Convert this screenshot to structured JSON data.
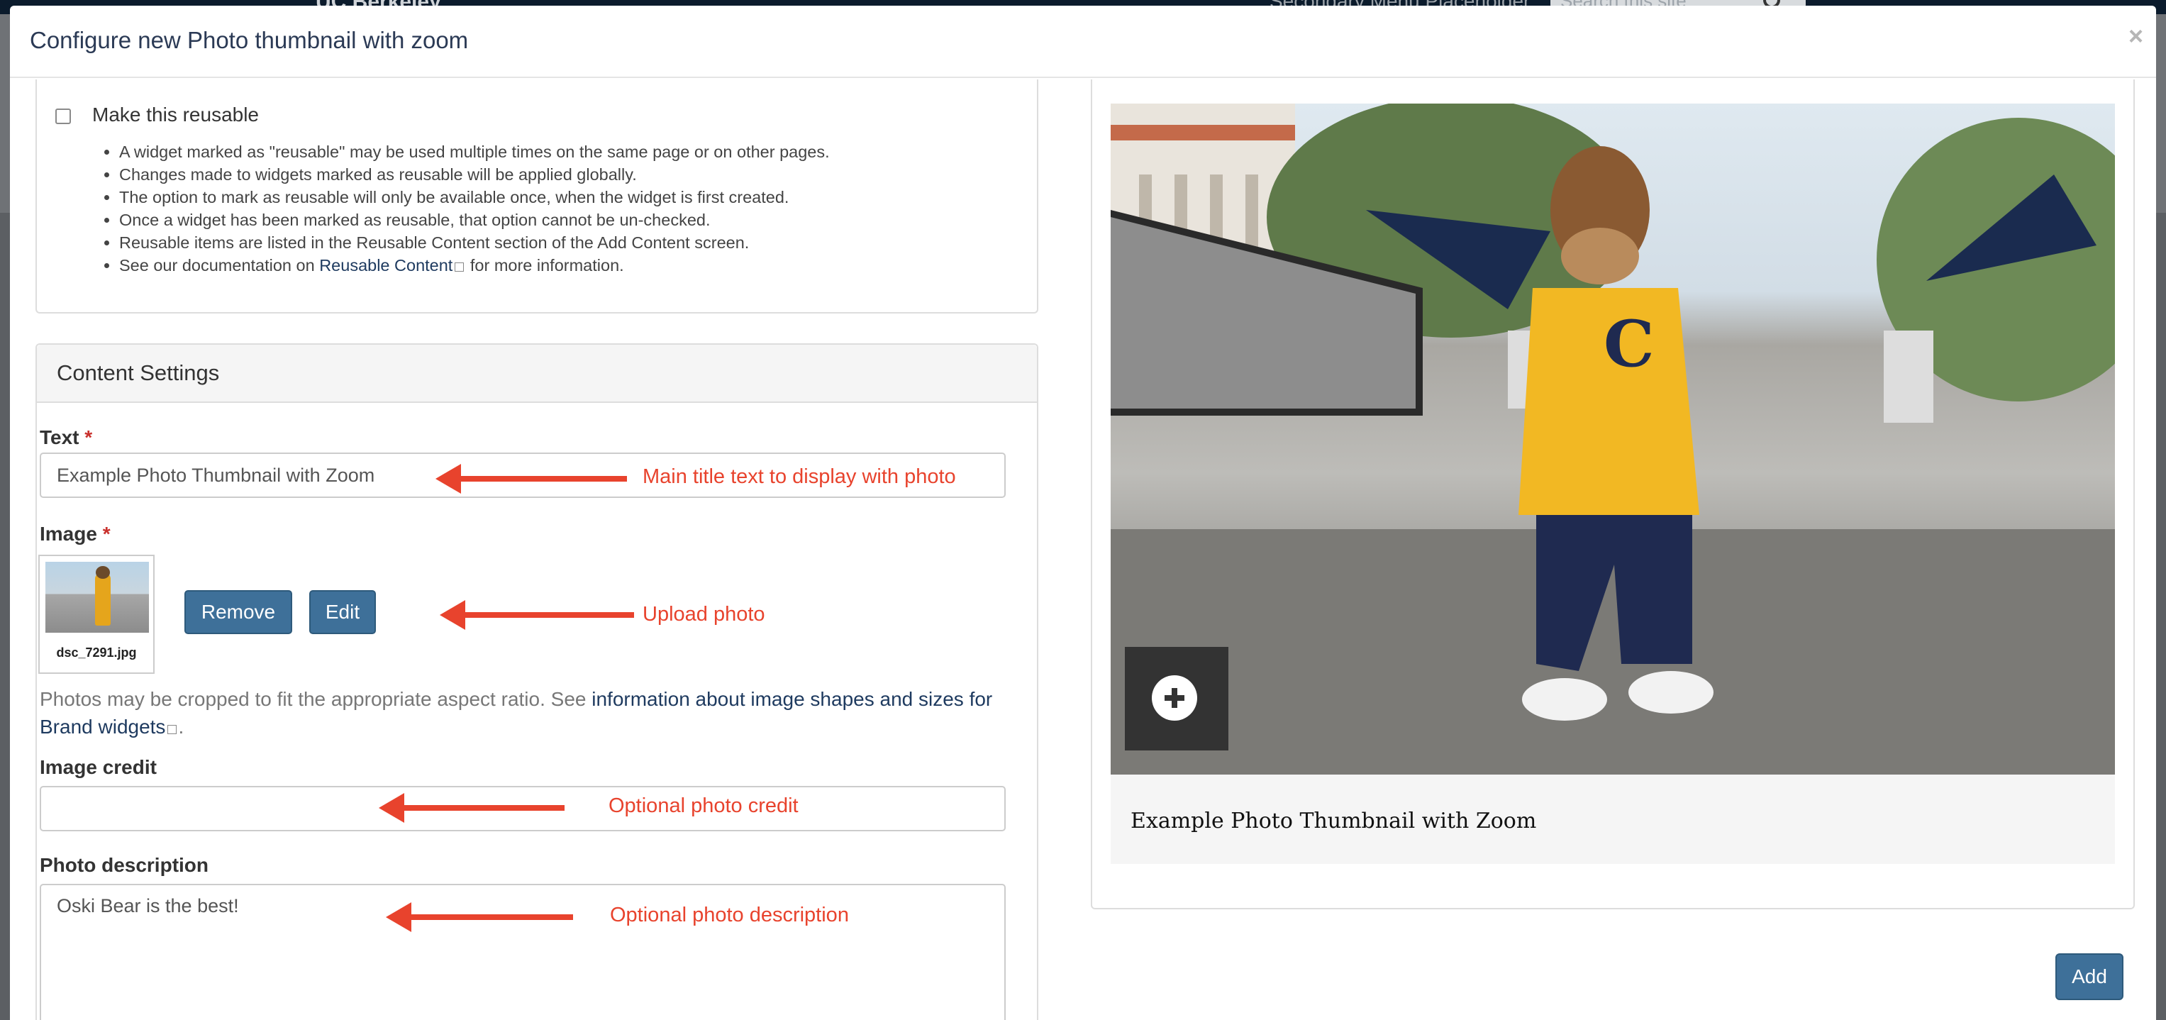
{
  "background_page": {
    "brand": "UC Berkeley",
    "menu": "Secondary Menu Placeholder",
    "search_placeholder": "Search this site"
  },
  "modal": {
    "title": "Configure new Photo thumbnail with zoom",
    "close_label": "×"
  },
  "reusable": {
    "label": "Make this reusable",
    "checked": false,
    "bullets": [
      "A widget marked as \"reusable\" may be used multiple times on the same page or on other pages.",
      "Changes made to widgets marked as reusable will be applied globally.",
      "The option to mark as reusable will only be available once, when the widget is first created.",
      "Once a widget has been marked as reusable, that option cannot be un-checked.",
      "Reusable items are listed in the Reusable Content section of the Add Content screen."
    ],
    "doc_prefix": "See our documentation on ",
    "doc_link": "Reusable Content",
    "doc_suffix": " for more information."
  },
  "content_settings": {
    "heading": "Content Settings",
    "text_field": {
      "label": "Text",
      "required_marker": "*",
      "value": "Example Photo Thumbnail with Zoom"
    },
    "image_field": {
      "label": "Image",
      "required_marker": "*",
      "filename": "dsc_7291.jpg",
      "remove_label": "Remove",
      "edit_label": "Edit"
    },
    "help": {
      "prefix": "Photos may be cropped to fit the appropriate aspect ratio. See ",
      "link": "information about image shapes and sizes for Brand widgets",
      "suffix": "."
    },
    "credit_field": {
      "label": "Image credit",
      "value": ""
    },
    "description_field": {
      "label": "Photo description",
      "value": "Oski Bear is the best!"
    }
  },
  "annotations": {
    "text": "Main title text to display with photo",
    "upload": "Upload photo",
    "credit": "Optional photo credit",
    "description": "Optional photo description",
    "color": "#e8432d"
  },
  "preview": {
    "caption": "Example Photo Thumbnail with Zoom",
    "zoom_icon": "plus-circle-icon"
  },
  "footer": {
    "add_label": "Add"
  },
  "colors": {
    "primary_button": "#3e7099",
    "link": "#1e3a5f",
    "required": "#c9302c"
  }
}
